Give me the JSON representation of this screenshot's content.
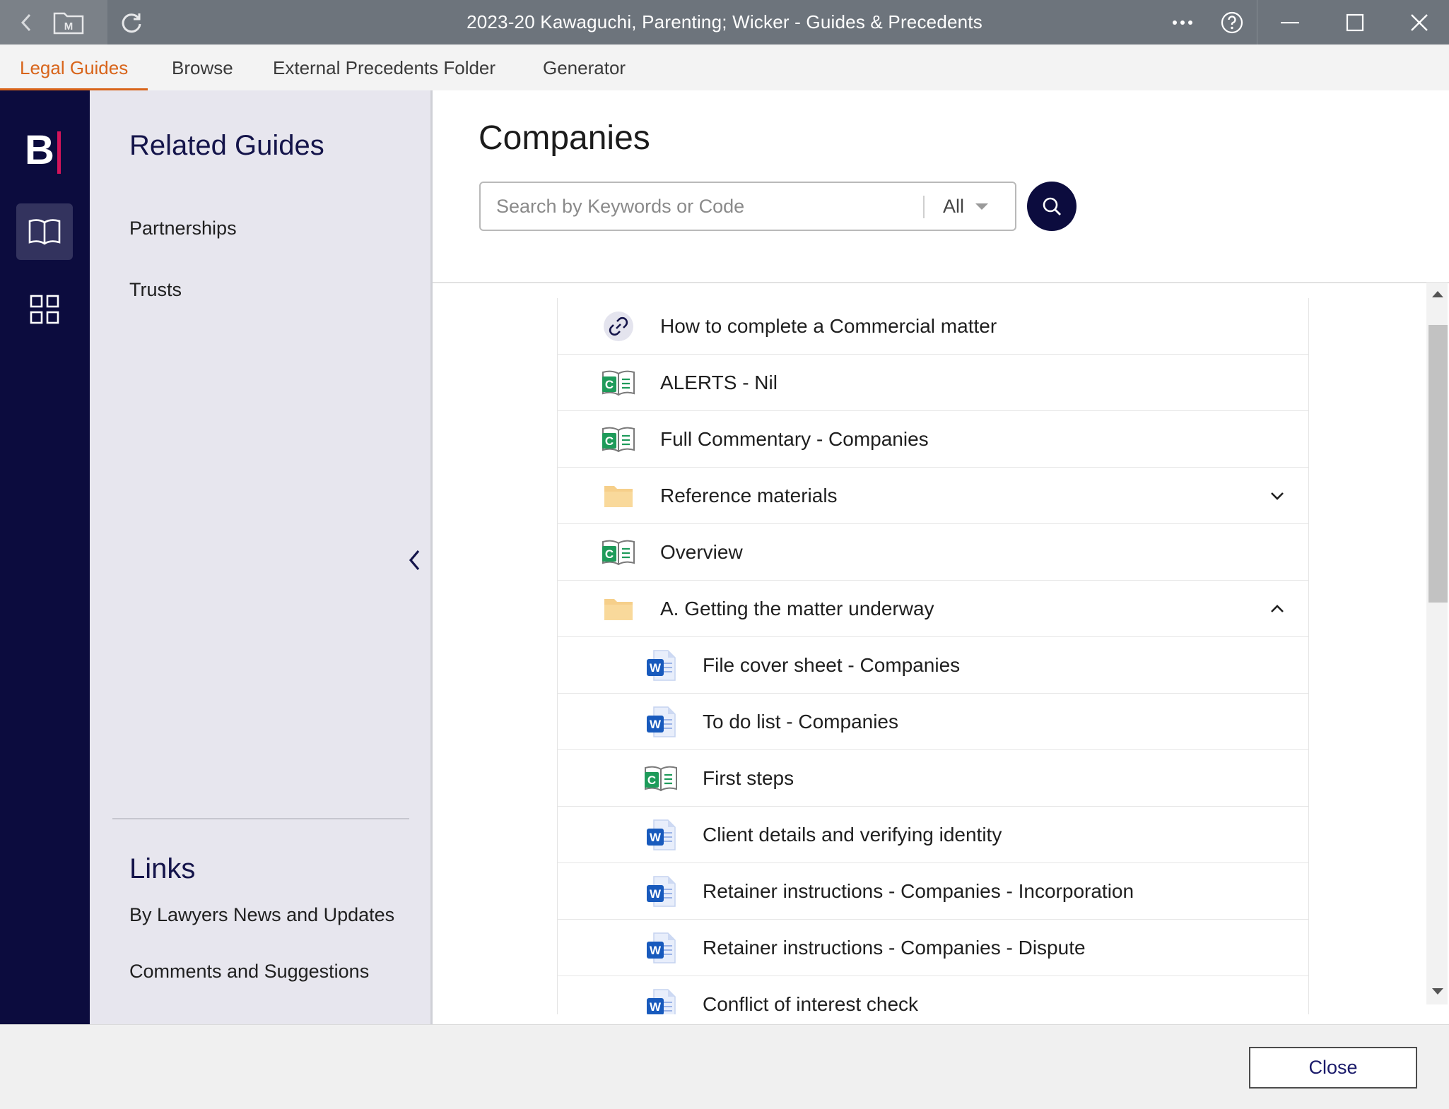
{
  "window": {
    "title": "2023-20 Kawaguchi, Parenting; Wicker - Guides & Precedents",
    "matter_icon_letter": "M"
  },
  "tabs": [
    {
      "label": "Legal Guides",
      "active": true
    },
    {
      "label": "Browse",
      "active": false
    },
    {
      "label": "External Precedents Folder",
      "active": false
    },
    {
      "label": "Generator",
      "active": false
    }
  ],
  "rail": {
    "logo_letter": "B",
    "items": [
      {
        "icon": "open-book-icon",
        "active": true
      },
      {
        "icon": "grid-icon",
        "active": false
      }
    ]
  },
  "related": {
    "heading": "Related Guides",
    "items": [
      "Partnerships",
      "Trusts"
    ],
    "links_heading": "Links",
    "links": [
      "By Lawyers News and Updates",
      "Comments and Suggestions"
    ]
  },
  "main": {
    "title": "Companies",
    "search": {
      "placeholder": "Search by Keywords or Code",
      "scope": "All"
    },
    "items": [
      {
        "label": "How to complete a Commercial matter",
        "icon": "link-icon",
        "level": 0
      },
      {
        "label": "ALERTS - Nil",
        "icon": "commentary-book-icon",
        "level": 0
      },
      {
        "label": "Full Commentary - Companies",
        "icon": "commentary-book-icon",
        "level": 0
      },
      {
        "label": "Reference materials",
        "icon": "folder-icon",
        "level": 0,
        "expander": "collapsed"
      },
      {
        "label": "Overview",
        "icon": "commentary-book-icon",
        "level": 0
      },
      {
        "label": "A. Getting the matter underway",
        "icon": "folder-icon",
        "level": 0,
        "expander": "expanded"
      },
      {
        "label": "File cover sheet - Companies",
        "icon": "word-doc-icon",
        "level": 1
      },
      {
        "label": "To do list - Companies",
        "icon": "word-doc-icon",
        "level": 1
      },
      {
        "label": "First steps",
        "icon": "commentary-book-icon",
        "level": 1
      },
      {
        "label": "Client details and verifying identity",
        "icon": "word-doc-icon",
        "level": 1
      },
      {
        "label": "Retainer instructions - Companies - Incorporation",
        "icon": "word-doc-icon",
        "level": 1
      },
      {
        "label": "Retainer instructions - Companies - Dispute",
        "icon": "word-doc-icon",
        "level": 1
      },
      {
        "label": "Conflict of interest check",
        "icon": "word-doc-icon",
        "level": 1
      }
    ]
  },
  "footer": {
    "close_label": "Close"
  },
  "colors": {
    "titlebar": "#6d747c",
    "accent_orange": "#d8641a",
    "navy": "#0c0c3e",
    "logo_bar": "#d4145a",
    "word_blue": "#185abd",
    "commentary_green": "#1e9b5a",
    "folder": "#f6cf8a"
  }
}
